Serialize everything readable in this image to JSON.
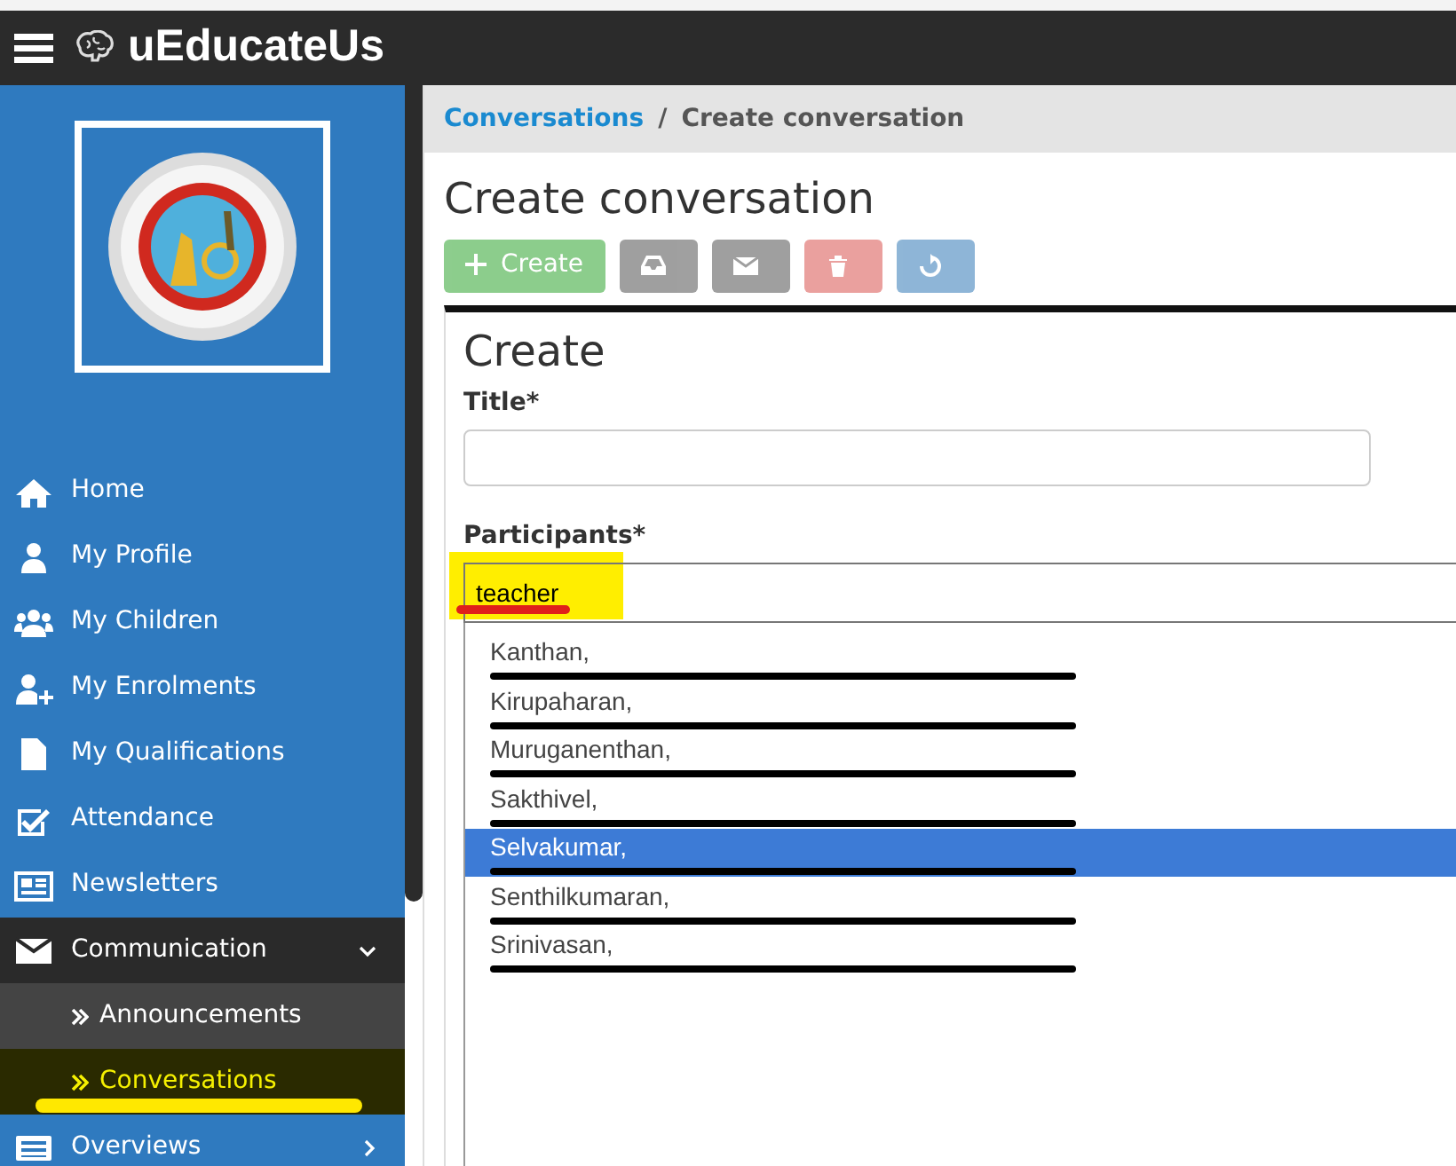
{
  "app": {
    "title": "uEducateUs"
  },
  "sidebar": {
    "items": [
      {
        "label": "Home",
        "kind": "link"
      },
      {
        "label": "My Profile",
        "kind": "link"
      },
      {
        "label": "My Children",
        "kind": "link"
      },
      {
        "label": "My Enrolments",
        "kind": "link"
      },
      {
        "label": "My Qualifications",
        "kind": "link"
      },
      {
        "label": "Attendance",
        "kind": "link"
      },
      {
        "label": "Newsletters",
        "kind": "link"
      },
      {
        "label": "Communication",
        "kind": "group",
        "expanded": true,
        "children": [
          {
            "label": "Announcements",
            "selected": false,
            "highlighted": false
          },
          {
            "label": "Conversations",
            "selected": true,
            "highlighted": true
          }
        ]
      },
      {
        "label": "Overviews",
        "kind": "group",
        "expanded": false
      }
    ]
  },
  "breadcrumb": [
    {
      "label": "Conversations",
      "kind": "link"
    },
    {
      "label": "/",
      "kind": "separator"
    },
    {
      "label": "Create conversation",
      "kind": "current"
    }
  ],
  "page_title": "Create conversation",
  "toolbar": [
    {
      "kind": "success",
      "label": "Create",
      "disabled": true
    },
    {
      "kind": "secondary",
      "disabled": true
    },
    {
      "kind": "secondary",
      "disabled": true
    },
    {
      "kind": "danger",
      "disabled": true
    },
    {
      "kind": "primary",
      "disabled": true
    }
  ],
  "form": {
    "heading": "Create",
    "title": {
      "label": "Title*"
    },
    "participants": {
      "label": "Participants*",
      "value": "teacher",
      "highlighted": true,
      "underlined": true,
      "options": [
        {
          "label": "Kanthan,",
          "selected": false,
          "redacted": true
        },
        {
          "label": "Kirupaharan,",
          "selected": false,
          "redacted": true
        },
        {
          "label": "Muruganenthan,",
          "selected": false,
          "redacted": true
        },
        {
          "label": "Sakthivel,",
          "selected": false,
          "redacted": true
        },
        {
          "label": "Selvakumar,",
          "selected": true,
          "redacted": true
        },
        {
          "label": "Senthilkumaran,",
          "selected": false,
          "redacted": true
        },
        {
          "label": "Srinivasan,",
          "selected": false,
          "redacted": true
        }
      ]
    }
  }
}
